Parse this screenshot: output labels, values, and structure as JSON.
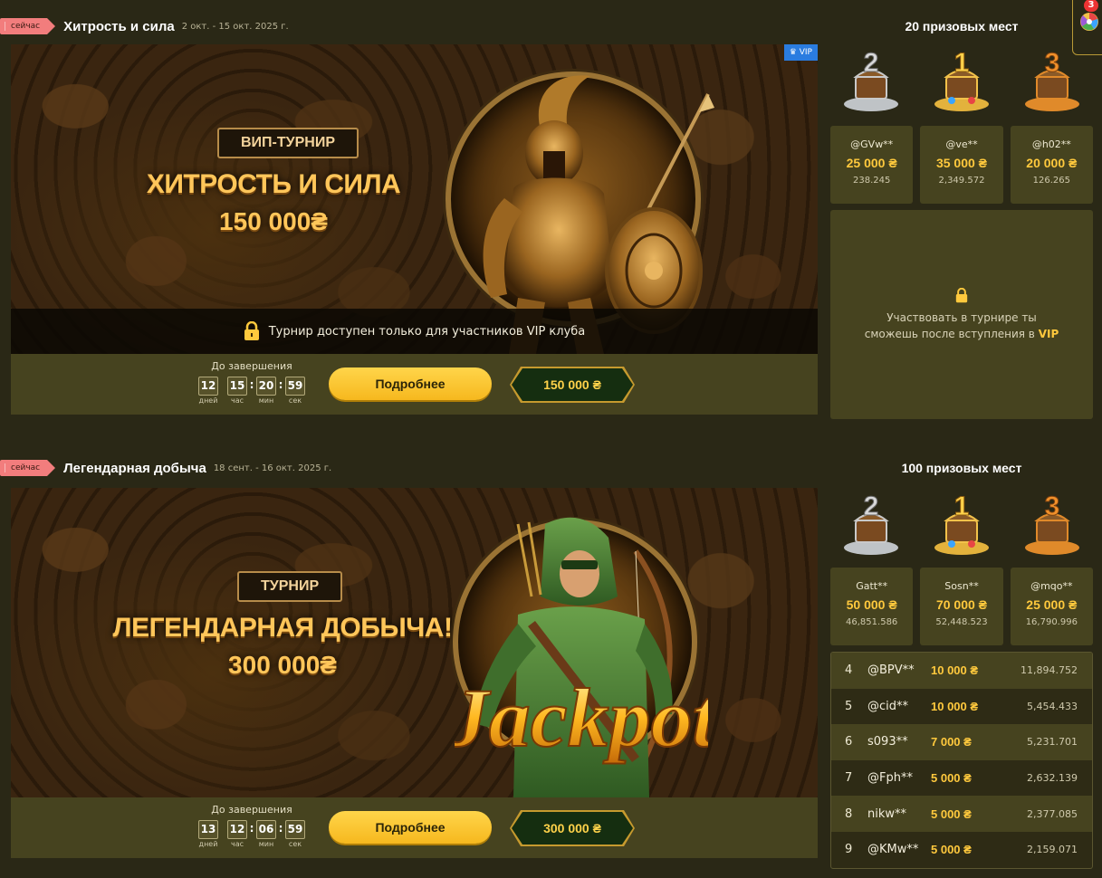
{
  "notifications": {
    "count": "3",
    "icon": "wheel-icon"
  },
  "tournaments": [
    {
      "badge": "сейчас",
      "title": "Хитрость и сила",
      "dates": "2 окт. - 15 окт. 2025 г.",
      "prize_places": "20 призовых мест",
      "banner": {
        "ribbon": "ВИП-ТУРНИР",
        "title": "ХИТРОСТЬ И СИЛА",
        "amount": "150 000₴",
        "vip_tag": "VIP",
        "locked_text": "Турнир доступен только для участников VIP клуба"
      },
      "countdown": {
        "label": "До завершения",
        "days": "12",
        "hours": "15",
        "minutes": "20",
        "seconds": "59",
        "days_unit": "дней",
        "hours_unit": "час",
        "minutes_unit": "мин",
        "seconds_unit": "сек"
      },
      "more_label": "Подробнее",
      "pool": "150 000 ₴",
      "podium": [
        {
          "place": "2",
          "name": "@GVw**",
          "prize": "25 000 ₴",
          "score": "238.245"
        },
        {
          "place": "1",
          "name": "@ve**",
          "prize": "35 000 ₴",
          "score": "2,349.572"
        },
        {
          "place": "3",
          "name": "@h02**",
          "prize": "20 000 ₴",
          "score": "126.265"
        }
      ],
      "vip_panel": {
        "line1": "Участвовать в турнире ты",
        "line2": "сможешь после вступления в",
        "accent": "VIP"
      }
    },
    {
      "badge": "сейчас",
      "title": "Легендарная добыча",
      "dates": "18 сент. - 16 окт. 2025 г.",
      "prize_places": "100 призовых мест",
      "banner": {
        "ribbon": "ТУРНИР",
        "title": "ЛЕГЕНДАРНАЯ ДОБЫЧА!",
        "amount": "300 000₴",
        "logo": "Jackpot"
      },
      "countdown": {
        "label": "До завершения",
        "days": "13",
        "hours": "12",
        "minutes": "06",
        "seconds": "59",
        "days_unit": "дней",
        "hours_unit": "час",
        "minutes_unit": "мин",
        "seconds_unit": "сек"
      },
      "more_label": "Подробнее",
      "pool": "300 000 ₴",
      "podium": [
        {
          "place": "2",
          "name": "Gatt**",
          "prize": "50 000 ₴",
          "score": "46,851.586"
        },
        {
          "place": "1",
          "name": "Sosn**",
          "prize": "70 000 ₴",
          "score": "52,448.523"
        },
        {
          "place": "3",
          "name": "@mqo**",
          "prize": "25 000 ₴",
          "score": "16,790.996"
        }
      ],
      "leaderboard": [
        {
          "rank": "4",
          "name": "@BPV**",
          "prize": "10 000 ₴",
          "score": "11,894.752"
        },
        {
          "rank": "5",
          "name": "@cid**",
          "prize": "10 000 ₴",
          "score": "5,454.433"
        },
        {
          "rank": "6",
          "name": "s093**",
          "prize": "7 000 ₴",
          "score": "5,231.701"
        },
        {
          "rank": "7",
          "name": "@Fph**",
          "prize": "5 000 ₴",
          "score": "2,632.139"
        },
        {
          "rank": "8",
          "name": "nikw**",
          "prize": "5 000 ₴",
          "score": "2,377.085"
        },
        {
          "rank": "9",
          "name": "@KMw**",
          "prize": "5 000 ₴",
          "score": "2,159.071"
        }
      ]
    }
  ],
  "colors": {
    "accent": "#ffc93d",
    "panel": "#46431f",
    "background": "#2a2816",
    "badge": "#f27d7d",
    "vip": "#2a7ce0"
  }
}
